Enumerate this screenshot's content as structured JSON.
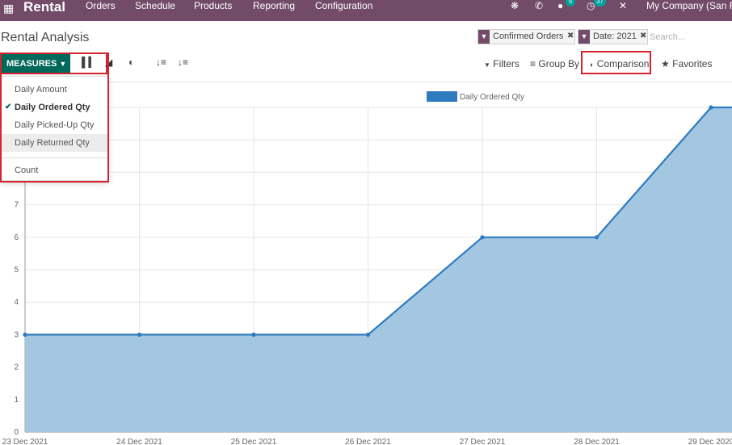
{
  "topbar": {
    "app_name": "Rental",
    "menus": [
      "Orders",
      "Schedule",
      "Products",
      "Reporting",
      "Configuration"
    ],
    "icons": [
      "apps-icon",
      "bug-icon",
      "phone-icon",
      "chat-icon",
      "activity-icon",
      "tools-icon"
    ],
    "chat_badge": "5",
    "activity_badge": "37",
    "company": "My Company (San Fra",
    "bar_color": "#714b67"
  },
  "control": {
    "title": "Rental Analysis",
    "facets": [
      {
        "label": "Confirmed Orders"
      },
      {
        "label": "Date: 2021"
      }
    ],
    "search_placeholder": "Search...",
    "measures_label": "MEASURES",
    "filters_label": "Filters",
    "groupby_label": "Group By",
    "comparison_label": "Comparison",
    "favorites_label": "Favorites",
    "accent": "#00695c"
  },
  "measures_menu": {
    "items": [
      "Daily Amount",
      "Daily Ordered Qty",
      "Daily Picked-Up Qty",
      "Daily Returned Qty"
    ],
    "selected": "Daily Ordered Qty",
    "hovered": "Daily Returned Qty",
    "count_label": "Count"
  },
  "chart_data": {
    "type": "area",
    "categories": [
      "23 Dec 2021",
      "24 Dec 2021",
      "25 Dec 2021",
      "26 Dec 2021",
      "27 Dec 2021",
      "28 Dec 2021",
      "29 Dec 2020"
    ],
    "series": [
      {
        "name": "Daily Ordered Qty",
        "values": [
          3,
          3,
          3,
          3,
          6,
          6,
          10
        ],
        "color": "#2e7bbf",
        "fill": "#a3c7e0"
      }
    ],
    "ylim": [
      0,
      10
    ],
    "yticks": [
      0,
      1,
      2,
      3,
      4,
      5,
      6,
      7,
      8,
      9,
      10
    ],
    "grid": true,
    "legend": "top-center"
  }
}
